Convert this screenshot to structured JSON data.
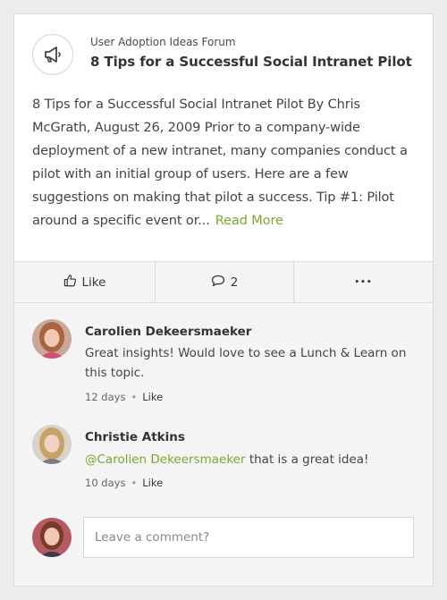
{
  "post": {
    "forum": "User Adoption Ideas Forum",
    "title": "8 Tips for a Successful Social Intranet Pilot",
    "excerpt": "8 Tips for a Successful Social Intranet Pilot By Chris McGrath, August 26, 2009 Prior to a company-wide deployment of a new intranet, many companies conduct a pilot with an initial group of users. Here are a few suggestions on making that pilot a success. Tip #1: Pilot around a specific event or...",
    "read_more": "Read More",
    "icon": "megaphone-icon"
  },
  "actions": {
    "like_label": "Like",
    "comment_count": "2",
    "more_label": "•••"
  },
  "comments": [
    {
      "author": "Carolien Dekeersmaeker",
      "text": "Great insights! Would love to see a Lunch & Learn on this topic.",
      "time": "12 days",
      "like": "Like"
    },
    {
      "author": "Christie Atkins",
      "mention": "@Carolien Dekeersmaeker",
      "text": " that is a great idea!",
      "time": "10 days",
      "like": "Like"
    }
  ],
  "composer": {
    "placeholder": "Leave a comment?"
  },
  "colors": {
    "accent": "#7aa82e",
    "card": "#f4f4f4",
    "border": "#dcdcdc"
  }
}
